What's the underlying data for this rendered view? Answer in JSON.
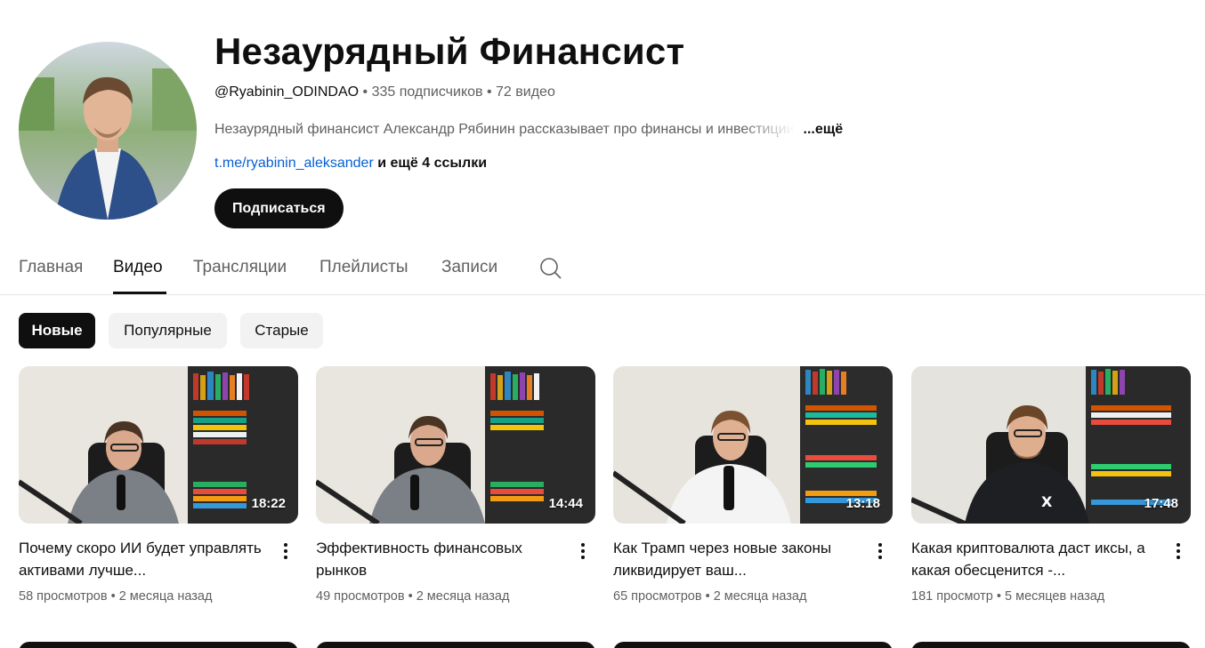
{
  "channel": {
    "title": "Незаурядный Финансист",
    "handle": "@Ryabinin_ODINDAO",
    "stats": " • 335 подписчиков • 72 видео",
    "description": "Незаурядный финансист Александр Рябинин рассказывает про финансы и инвестиции",
    "description_more": "...ещё",
    "link": "t.me/ryabinin_aleksander",
    "more_links": " и ещё 4 ссылки",
    "subscribe_label": "Подписаться"
  },
  "tabs": [
    {
      "label": "Главная"
    },
    {
      "label": "Видео"
    },
    {
      "label": "Трансляции"
    },
    {
      "label": "Плейлисты"
    },
    {
      "label": "Записи"
    }
  ],
  "active_tab": "Видео",
  "chips": [
    {
      "label": "Новые"
    },
    {
      "label": "Популярные"
    },
    {
      "label": "Старые"
    }
  ],
  "active_chip": "Новые",
  "videos": [
    {
      "title": "Почему скоро ИИ будет управлять активами лучше...",
      "duration": "18:22",
      "views": "58 просмотров",
      "age": "2 месяца назад"
    },
    {
      "title": "Эффективность финансовых рынков",
      "duration": "14:44",
      "views": "49 просмотров",
      "age": "2 месяца назад"
    },
    {
      "title": "Как Трамп через новые законы ликвидирует ваш...",
      "duration": "13:18",
      "views": "65 просмотров",
      "age": "2 месяца назад"
    },
    {
      "title": "Какая криптовалюта даст иксы, а какая обесценится -...",
      "duration": "17:48",
      "views": "181 просмотр",
      "age": "5 месяцев назад"
    }
  ],
  "meta_separator": " • ",
  "colors": {
    "accent": "#0f0f0f",
    "link": "#065fd4",
    "muted": "#606060",
    "chip_bg": "#f2f2f2"
  },
  "icons": {
    "search": "search-icon",
    "more": "more-vert-icon"
  }
}
